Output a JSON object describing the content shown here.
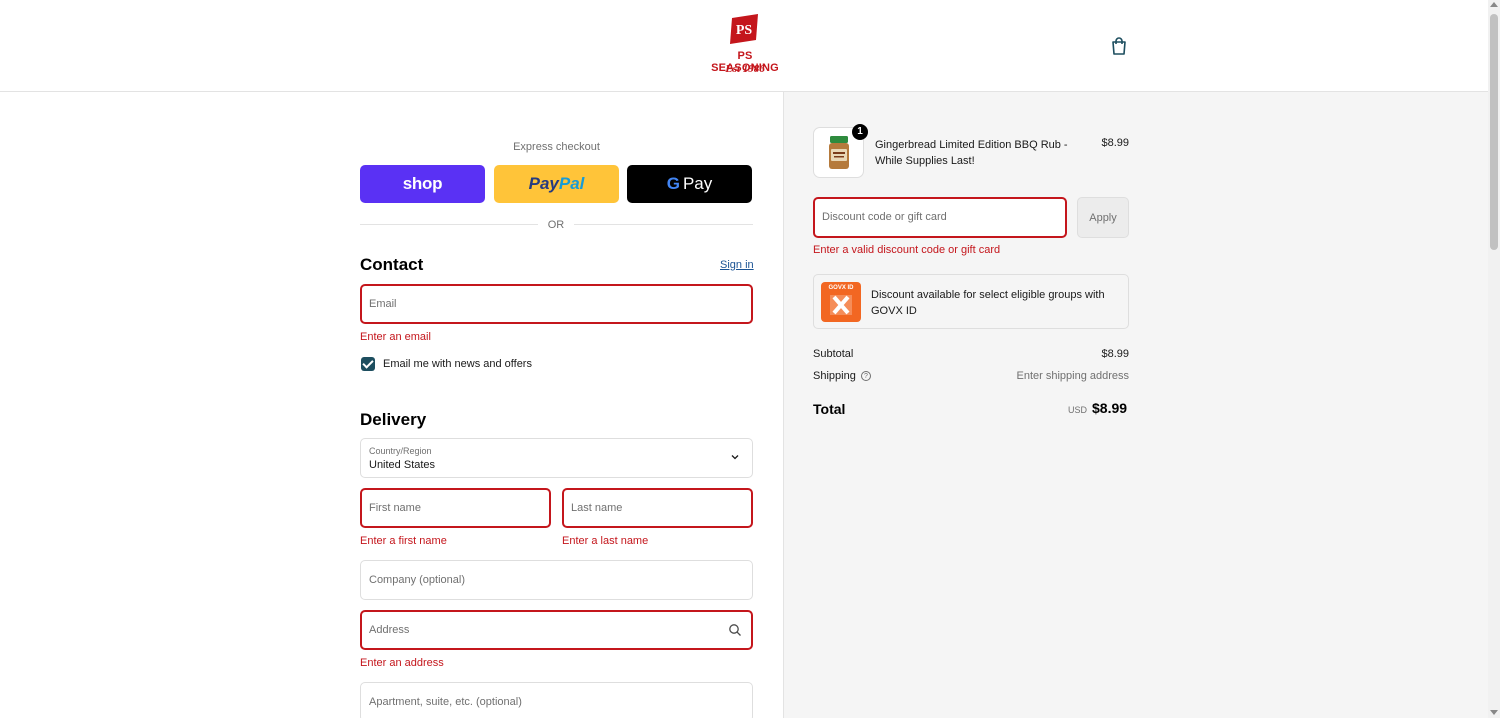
{
  "brand": {
    "logo_text": "PS",
    "name": "PS SEASONING",
    "established": "Est 1986",
    "color": "#c4161c"
  },
  "express": {
    "title": "Express checkout",
    "shop_label": "shop",
    "paypal_part1": "Pay",
    "paypal_part2": "Pal",
    "gpay_g": "G",
    "gpay_label": "Pay",
    "or_label": "OR"
  },
  "contact": {
    "title": "Contact",
    "signin_label": "Sign in",
    "email_placeholder": "Email",
    "email_error": "Enter an email",
    "newsletter_label": "Email me with news and offers",
    "newsletter_checked": true
  },
  "delivery": {
    "title": "Delivery",
    "country_label": "Country/Region",
    "country_value": "United States",
    "first_name_placeholder": "First name",
    "first_name_error": "Enter a first name",
    "last_name_placeholder": "Last name",
    "last_name_error": "Enter a last name",
    "company_placeholder": "Company (optional)",
    "address_placeholder": "Address",
    "address_error": "Enter an address",
    "apartment_placeholder": "Apartment, suite, etc. (optional)"
  },
  "summary": {
    "product": {
      "quantity": "1",
      "name": "Gingerbread Limited Edition BBQ Rub - While Supplies Last!",
      "price": "$8.99"
    },
    "discount": {
      "placeholder": "Discount code or gift card",
      "apply_label": "Apply",
      "error": "Enter a valid discount code or gift card"
    },
    "govx": {
      "logo_text": "GOVX ID",
      "text": "Discount available for select eligible groups with GOVX ID"
    },
    "subtotal_label": "Subtotal",
    "subtotal_value": "$8.99",
    "shipping_label": "Shipping",
    "shipping_value": "Enter shipping address",
    "total_label": "Total",
    "total_currency": "USD",
    "total_value": "$8.99"
  },
  "colors": {
    "error": "#c4161c",
    "shop": "#5a31f4",
    "paypal": "#ffc439",
    "gpay": "#000000",
    "checkbox": "#1d4e5f",
    "panel_bg": "#f5f5f5"
  },
  "icons": [
    "bag-icon",
    "chevron-down-icon",
    "search-icon",
    "help-icon",
    "checkmark-icon"
  ]
}
